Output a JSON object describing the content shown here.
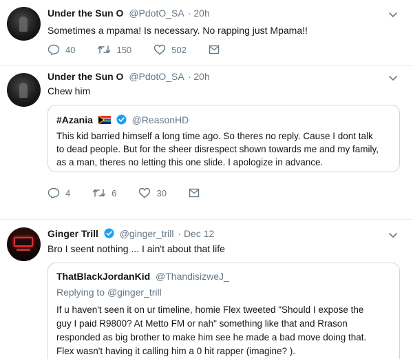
{
  "tweets": [
    {
      "name": "Under the Sun O",
      "handle": "@PdotO_SA",
      "time": "· 20h",
      "text": "Sometimes a mpama! Is necessary.  No rapping just Mpama!!",
      "replies": "40",
      "retweets": "150",
      "likes": "502"
    },
    {
      "name": "Under the Sun O",
      "handle": "@PdotO_SA",
      "time": "· 20h",
      "text": "Chew him",
      "replies": "4",
      "retweets": "6",
      "likes": "30",
      "quote": {
        "name": "#Azania",
        "handle": "@ReasonHD",
        "lines": [
          "This kid barried himself a long time ago. So theres no reply. Cause I dont talk",
          "to dead people. But for the sheer disrespect shown towards me and my family,",
          "as a man, theres no letting this one slide. I apologize in advance."
        ]
      }
    },
    {
      "name": "Ginger Trill",
      "handle": "@ginger_trill",
      "time": "· Dec 12",
      "text": "Bro I seent nothing ... I ain't about that life",
      "quote": {
        "name": "ThatBlackJordanKid",
        "handle": "@ThandisizweJ_",
        "replying_prefix": "Replying to",
        "replying_to": "@ginger_trill",
        "lines": [
          "If u haven't seen it on ur timeline, homie Flex tweeted \"Should I expose the",
          "guy I paid R9800? At Metto FM or nah\" something like that and Rrason",
          "responded as big brother to make him see he made a bad move doing that.",
          "Flex wasn't having it calling him a 0 hit rapper (imagine? )."
        ]
      }
    }
  ],
  "colors": {
    "text": "#14171a",
    "muted": "#657786",
    "verified": "#1da1f2",
    "border": "#ccd6dd"
  },
  "icons": [
    "reply-icon",
    "retweet-icon",
    "like-icon",
    "message-icon",
    "chevron-down-icon",
    "verified-icon",
    "south-africa-flag-icon"
  ]
}
